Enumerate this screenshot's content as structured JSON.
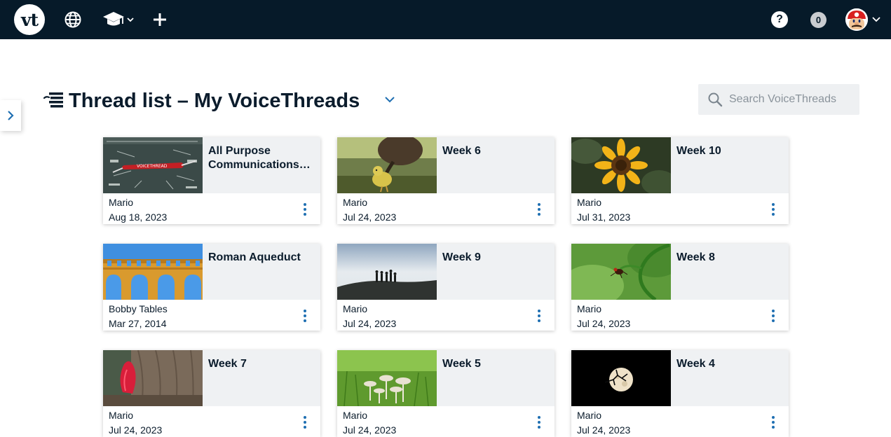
{
  "topbar": {
    "logo_text": "vt",
    "icons": [
      "globe-icon",
      "graduation-cap-icon",
      "plus-icon",
      "help-icon",
      "avatar"
    ],
    "help_label": "?",
    "notification_count": "0"
  },
  "header": {
    "title": "Thread list – My VoiceThreads",
    "search_placeholder": "Search VoiceThreads"
  },
  "threads": [
    {
      "title": "All Purpose Communications Tool",
      "author": "Mario",
      "date": "Aug 18, 2023",
      "thumb": "chalkboard-knife"
    },
    {
      "title": "Week 6",
      "author": "Mario",
      "date": "Jul 24, 2023",
      "thumb": "gosling"
    },
    {
      "title": "Week 10",
      "author": "Mario",
      "date": "Jul 31, 2023",
      "thumb": "sunflower"
    },
    {
      "title": "Roman Aqueduct",
      "author": "Bobby Tables",
      "date": "Mar 27, 2014",
      "thumb": "aqueduct"
    },
    {
      "title": "Week 9",
      "author": "Mario",
      "date": "Jul 24, 2023",
      "thumb": "hikers-fog"
    },
    {
      "title": "Week 8",
      "author": "Mario",
      "date": "Jul 24, 2023",
      "thumb": "insect-plant"
    },
    {
      "title": "Week 7",
      "author": "Mario",
      "date": "Jul 24, 2023",
      "thumb": "red-fungus"
    },
    {
      "title": "Week 5",
      "author": "Mario",
      "date": "Jul 24, 2023",
      "thumb": "mushrooms"
    },
    {
      "title": "Week 4",
      "author": "Mario",
      "date": "Jul 24, 2023",
      "thumb": "moon"
    }
  ],
  "colors": {
    "topbar_bg": "#061a29",
    "card_top_bg": "#eff1f3",
    "accent": "#1f6fb2",
    "text": "#0b1c2c"
  }
}
